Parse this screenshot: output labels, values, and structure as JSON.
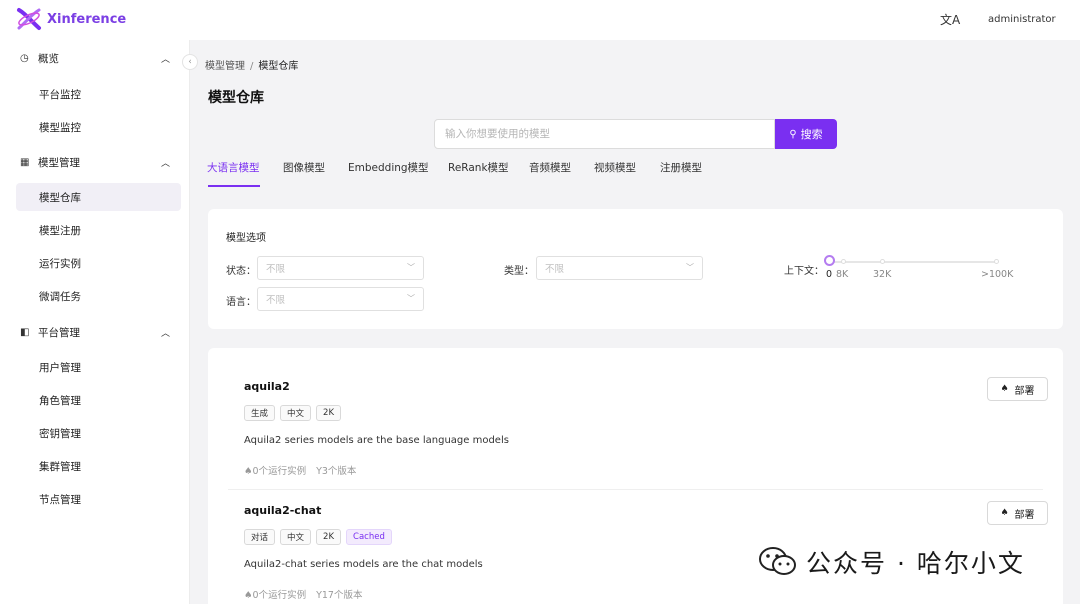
{
  "app": {
    "name": "Xinference",
    "brand_color": "#7a2ff1",
    "language_icon": "translate-icon",
    "user": "administrator"
  },
  "sidebar": {
    "groups": [
      {
        "label": "概览",
        "icon": "dashboard-icon",
        "items": [
          {
            "label": "平台监控"
          },
          {
            "label": "模型监控"
          }
        ]
      },
      {
        "label": "模型管理",
        "icon": "table-icon",
        "items": [
          {
            "label": "模型仓库",
            "active": true
          },
          {
            "label": "模型注册"
          },
          {
            "label": "运行实例"
          },
          {
            "label": "微调任务"
          }
        ]
      },
      {
        "label": "平台管理",
        "icon": "panel-icon",
        "items": [
          {
            "label": "用户管理"
          },
          {
            "label": "角色管理"
          },
          {
            "label": "密钥管理"
          },
          {
            "label": "集群管理"
          },
          {
            "label": "节点管理"
          }
        ]
      }
    ]
  },
  "breadcrumb": {
    "parent": "模型管理",
    "separator": "/",
    "current": "模型仓库"
  },
  "page": {
    "title": "模型仓库"
  },
  "search": {
    "placeholder": "输入你想要使用的模型",
    "value": "",
    "button_label": "搜索"
  },
  "tabs": [
    {
      "label": "大语言模型",
      "active": true
    },
    {
      "label": "图像模型"
    },
    {
      "label": "Embedding模型"
    },
    {
      "label": "ReRank模型"
    },
    {
      "label": "音频模型"
    },
    {
      "label": "视频模型"
    },
    {
      "label": "注册模型"
    }
  ],
  "filters": {
    "title": "模型选项",
    "status_label": "状态：",
    "status_value": "不限",
    "type_label": "类型：",
    "type_value": "不限",
    "language_label": "语言：",
    "language_value": "不限",
    "context_label": "上下文：",
    "context_marks": [
      "0",
      "8K",
      "32K",
      ">100K"
    ],
    "context_selected": "0"
  },
  "models": [
    {
      "name": "aquila2",
      "tags": [
        {
          "text": "生成"
        },
        {
          "text": "中文"
        },
        {
          "text": "2K"
        }
      ],
      "description": "Aquila2 series models are the base language models",
      "instances": "0个运行实例",
      "versions": "3个版本",
      "deploy_label": "部署"
    },
    {
      "name": "aquila2-chat",
      "tags": [
        {
          "text": "对话"
        },
        {
          "text": "中文"
        },
        {
          "text": "2K"
        },
        {
          "text": "Cached",
          "cached": true
        }
      ],
      "description": "Aquila2-chat series models are the chat models",
      "instances": "0个运行实例",
      "versions": "17个版本",
      "deploy_label": "部署"
    }
  ],
  "watermark": {
    "text": "公众号 · 哈尔小文",
    "icon": "wechat-icon"
  }
}
